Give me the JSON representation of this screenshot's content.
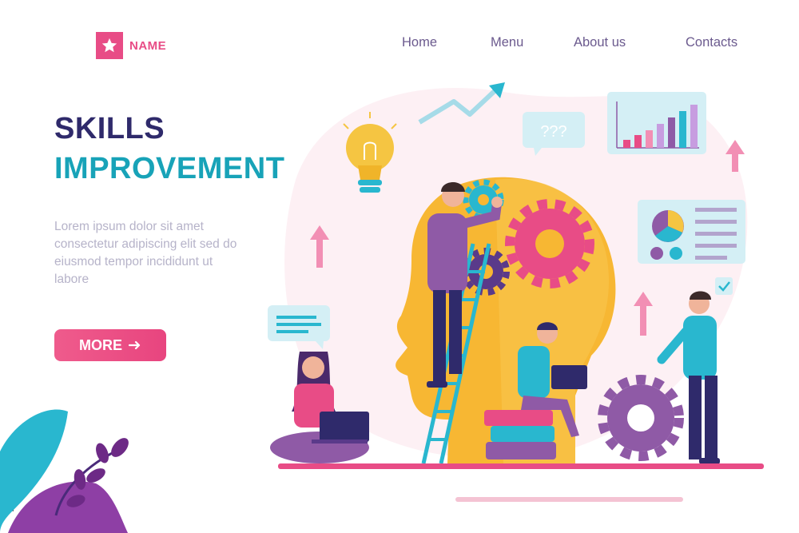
{
  "brand": {
    "name": "NAME",
    "icon": "star-icon"
  },
  "nav": {
    "items": [
      {
        "label": "Home"
      },
      {
        "label": "Menu"
      },
      {
        "label": "About us"
      },
      {
        "label": "Contacts"
      }
    ]
  },
  "hero": {
    "title_line1": "SKILLS",
    "title_line2": "IMPROVEMENT",
    "body": "Lorem ipsum dolor sit amet consectetur adipiscing elit sed do eiusmod tempor incididunt ut labore",
    "cta_label": "MORE",
    "cta_icon": "arrow-right-icon"
  },
  "illustration": {
    "speech_bubble_text": "???"
  },
  "stock_id": "470899087",
  "colors": {
    "brand_pink": "#e84c86",
    "title_dark": "#2f2a6b",
    "title_teal": "#18a3b8",
    "head_yellow": "#f7b733",
    "purple": "#8f5aa6"
  }
}
